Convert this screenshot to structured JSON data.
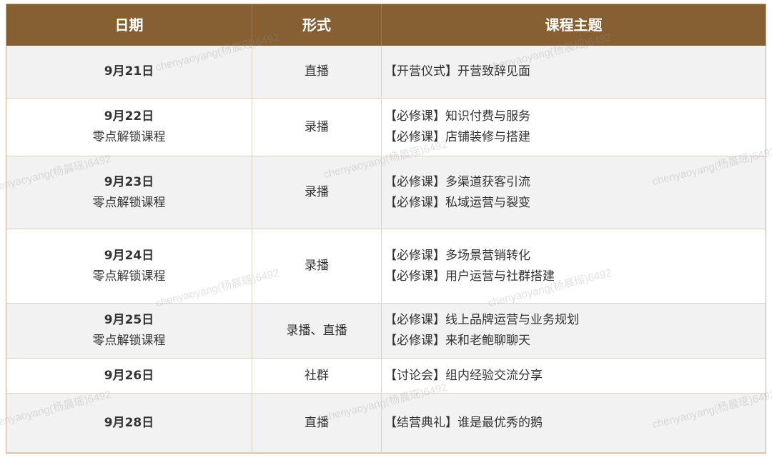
{
  "headers": [
    "日期",
    "形式",
    "课程主题"
  ],
  "rows": [
    {
      "date": "9月21日",
      "sub": "",
      "format": "直播",
      "topics": [
        "【开营仪式】开营致辞见面"
      ]
    },
    {
      "date": "9月22日",
      "sub": "零点解锁课程",
      "format": "录播",
      "topics": [
        "【必修课】知识付费与服务",
        "【必修课】店铺装修与搭建"
      ]
    },
    {
      "date": "9月23日",
      "sub": "零点解锁课程",
      "format": "录播",
      "topics": [
        "【必修课】多渠道获客引流",
        "【必修课】私域运营与裂变"
      ]
    },
    {
      "date": "9月24日",
      "sub": "零点解锁课程",
      "format": "录播",
      "topics": [
        "【必修课】多场景营销转化",
        "【必修课】用户运营与社群搭建"
      ]
    },
    {
      "date": "9月25日",
      "sub": "零点解锁课程",
      "format": "录播、直播",
      "topics": [
        "【必修课】线上品牌运营与业务规划",
        "【必修课】来和老鲍聊聊天"
      ]
    },
    {
      "date": "9月26日",
      "sub": "",
      "format": "社群",
      "topics": [
        "【讨论会】组内经验交流分享"
      ]
    },
    {
      "date": "9月28日",
      "sub": "",
      "format": "直播",
      "topics": [
        "【结营典礼】谁是最优秀的鹅"
      ]
    }
  ],
  "watermark": "chenyaoyang(杨晨瑶)6492",
  "colors": {
    "header_bg": "#865f33",
    "odd_row": "#f2f2f2",
    "even_row": "#ffffff",
    "border": "#dcd2c0"
  }
}
